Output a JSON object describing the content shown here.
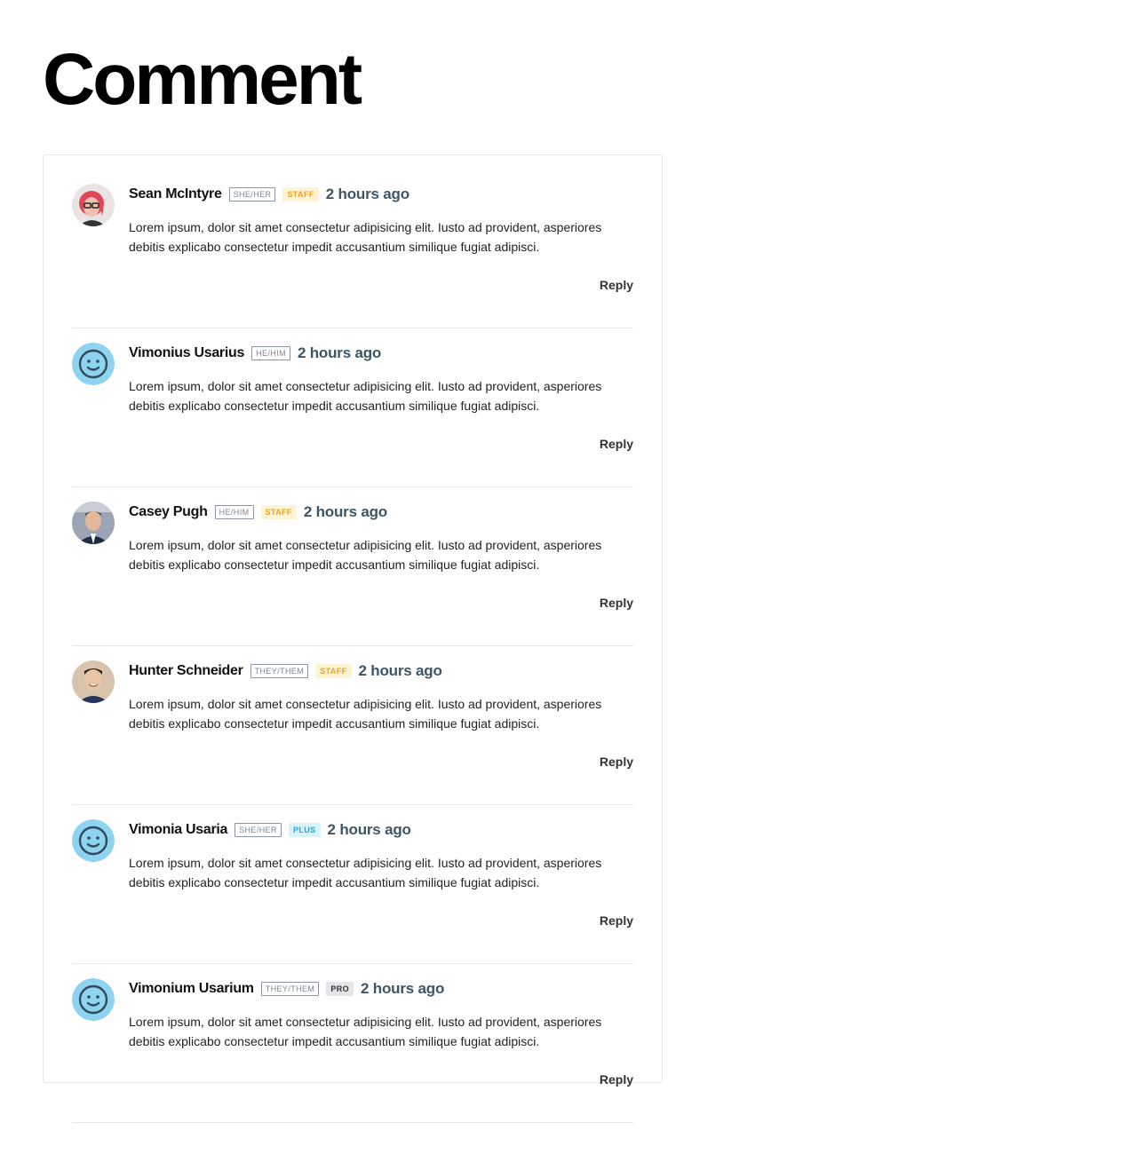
{
  "page": {
    "title": "Comment"
  },
  "comments": [
    {
      "author": "Sean McIntyre",
      "pronoun": "SHE/HER",
      "badge": "STAFF",
      "badge_type": "staff",
      "time": "2 hours ago",
      "text": "Lorem ipsum, dolor sit amet consectetur adipisicing elit. Iusto ad provident, asperiores debitis explicabo consectetur impedit accusantium similique fugiat adipisci.",
      "reply_label": "Reply",
      "avatar": "photo-woman-red-hair"
    },
    {
      "author": "Vimonius Usarius",
      "pronoun": "HE/HIM",
      "badge": "",
      "badge_type": "",
      "time": "2 hours ago",
      "text": "Lorem ipsum, dolor sit amet consectetur adipisicing elit. Iusto ad provident, asperiores debitis explicabo consectetur impedit accusantium similique fugiat adipisci.",
      "reply_label": "Reply",
      "avatar": "default-smiley"
    },
    {
      "author": "Casey Pugh",
      "pronoun": "HE/HIM",
      "badge": "STAFF",
      "badge_type": "staff",
      "time": "2 hours ago",
      "text": "Lorem ipsum, dolor sit amet consectetur adipisicing elit. Iusto ad provident, asperiores debitis explicabo consectetur impedit accusantium similique fugiat adipisci.",
      "reply_label": "Reply",
      "avatar": "photo-man-suit"
    },
    {
      "author": "Hunter Schneider",
      "pronoun": "THEY/THEM",
      "badge": "STAFF",
      "badge_type": "staff",
      "time": "2 hours ago",
      "text": "Lorem ipsum, dolor sit amet consectetur adipisicing elit. Iusto ad provident, asperiores debitis explicabo consectetur impedit accusantium similique fugiat adipisci.",
      "reply_label": "Reply",
      "avatar": "photo-man-smiling"
    },
    {
      "author": "Vimonia Usaria",
      "pronoun": "SHE/HER",
      "badge": "PLUS",
      "badge_type": "plus",
      "time": "2 hours ago",
      "text": "Lorem ipsum, dolor sit amet consectetur adipisicing elit. Iusto ad provident, asperiores debitis explicabo consectetur impedit accusantium similique fugiat adipisci.",
      "reply_label": "Reply",
      "avatar": "default-smiley"
    },
    {
      "author": "Vimonium Usarium",
      "pronoun": "THEY/THEM",
      "badge": "PRO",
      "badge_type": "pro",
      "time": "2 hours ago",
      "text": "Lorem ipsum, dolor sit amet consectetur adipisicing elit. Iusto ad provident, asperiores debitis explicabo consectetur impedit accusantium similique fugiat adipisci.",
      "reply_label": "Reply",
      "avatar": "default-smiley"
    }
  ],
  "colors": {
    "smiley_bg": "#8ed3ef",
    "smiley_stroke": "#2f4a5a",
    "time": "#3e5566",
    "staff_text": "#f0a11a",
    "plus_text": "#22a7d4"
  }
}
